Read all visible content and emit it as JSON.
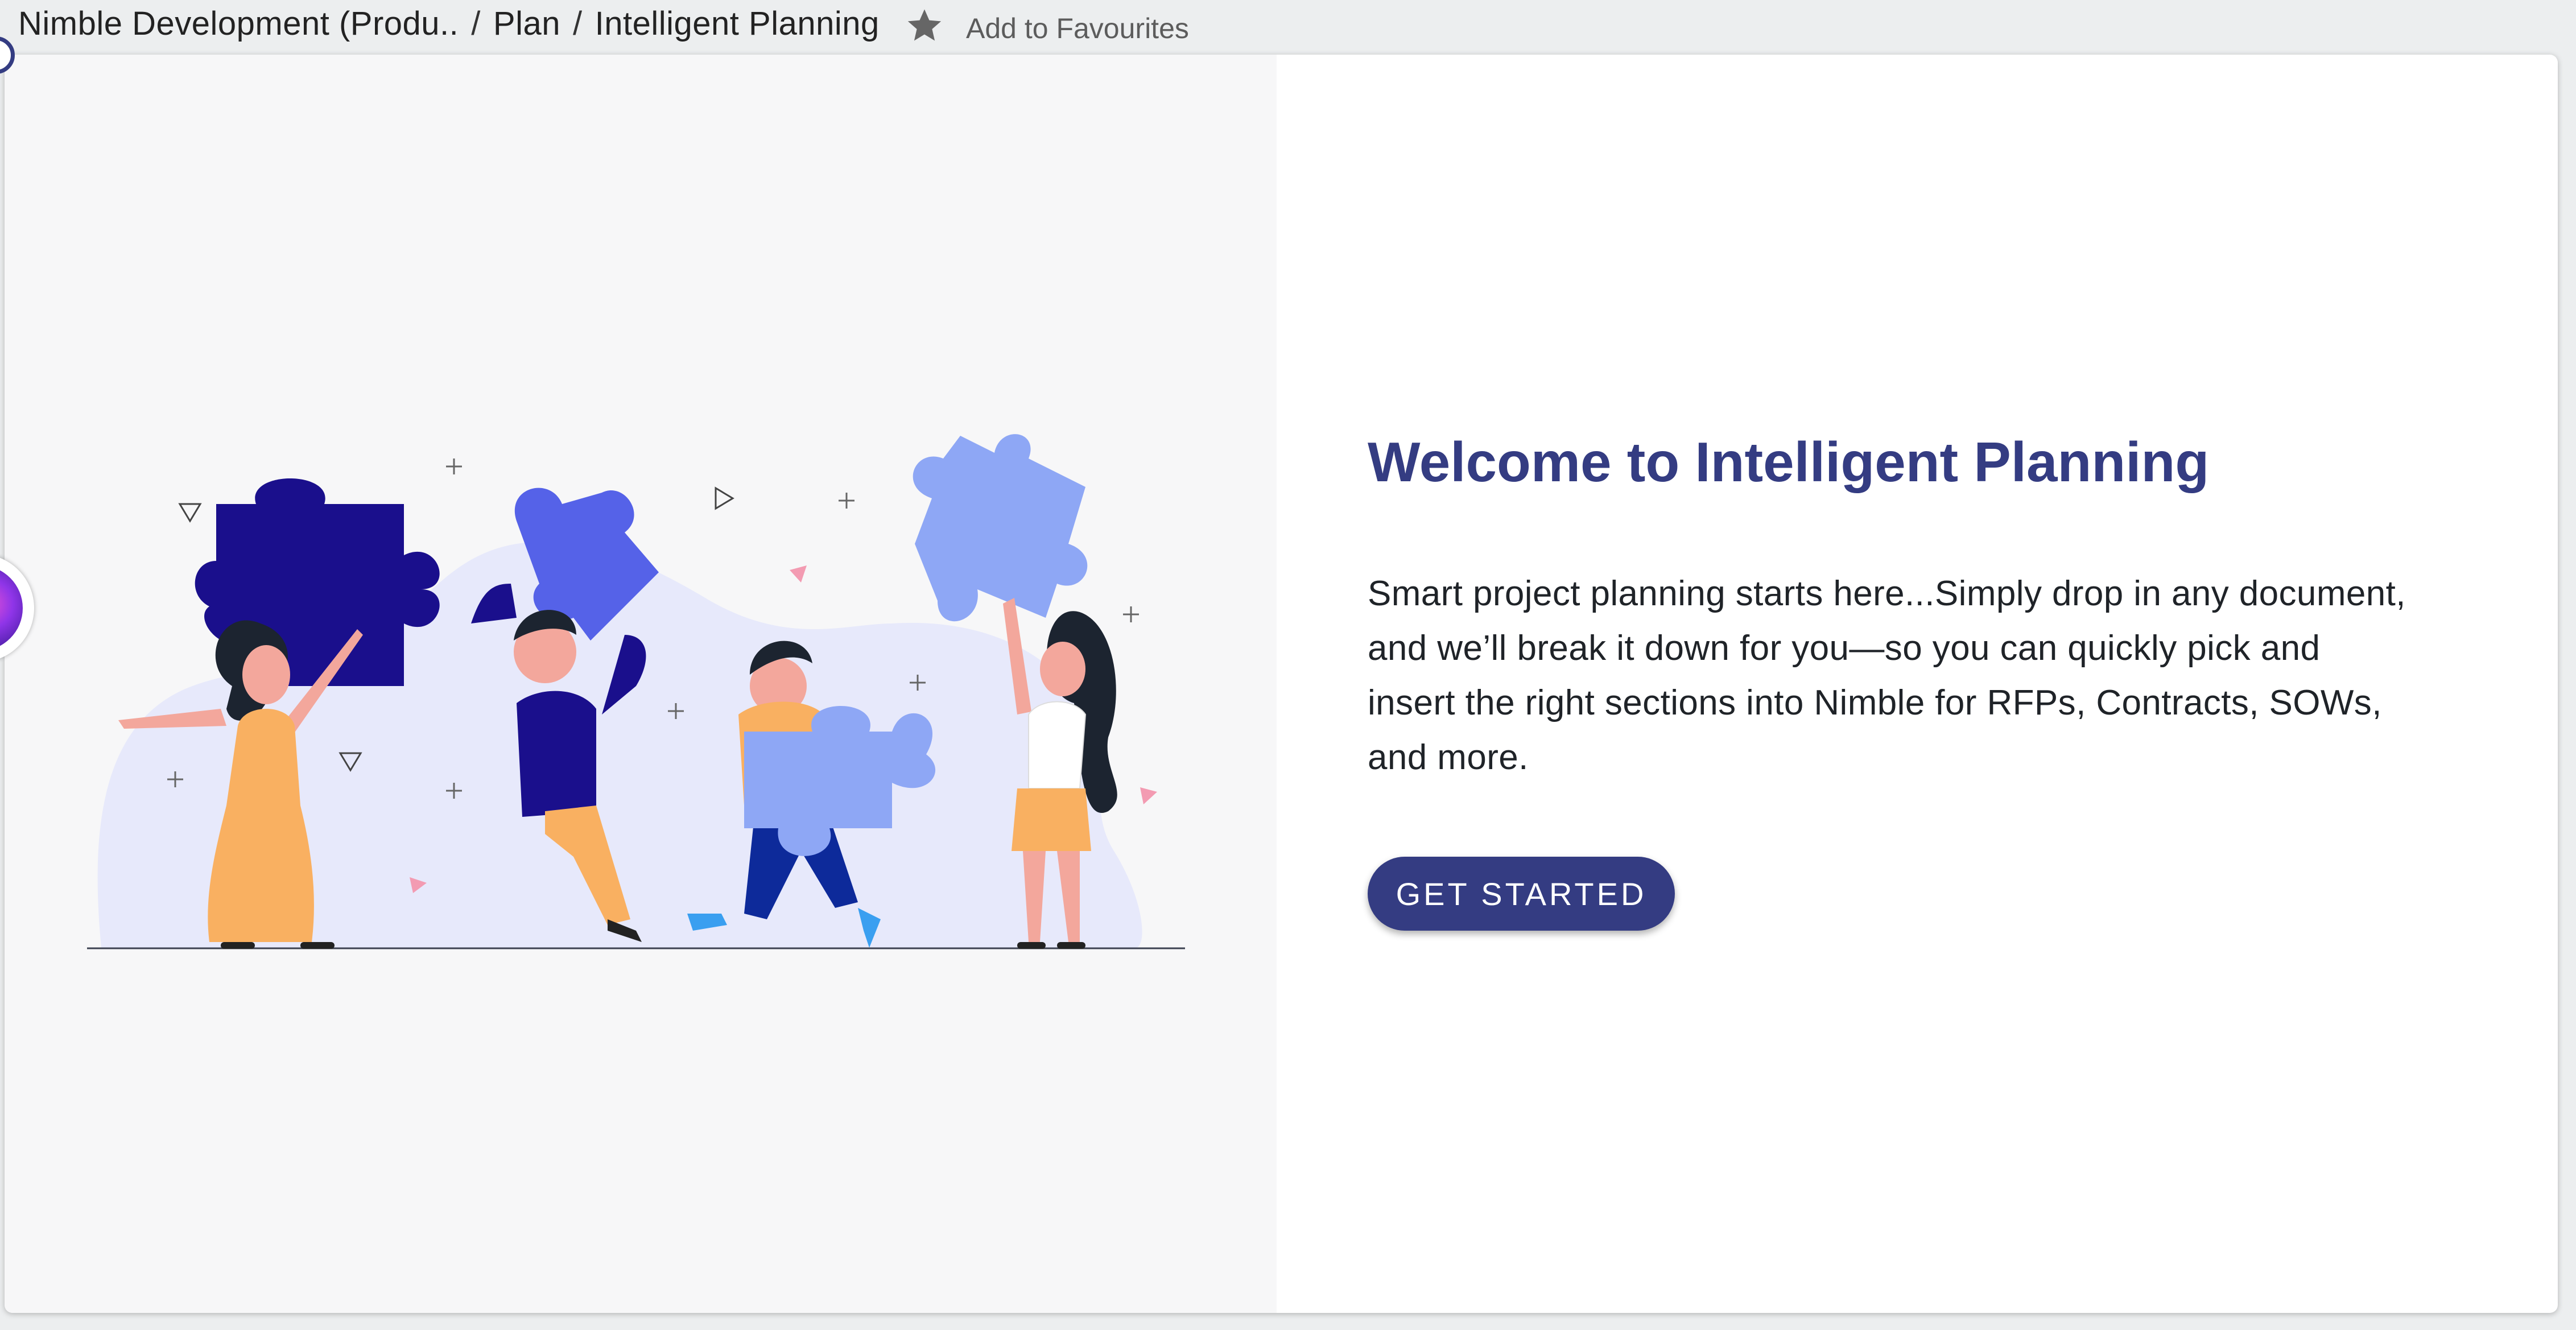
{
  "breadcrumb": {
    "items": [
      "Nimble Development (Produ..",
      "Plan",
      "Intelligent Planning"
    ],
    "separator": "/"
  },
  "favourites": {
    "label": "Add to Favourites",
    "icon": "star-icon"
  },
  "welcome": {
    "title": "Welcome to Intelligent Planning",
    "description": "Smart project planning starts here...Simply drop in any document, and we’ll break it down for you—so you can quickly pick and insert the right sections into Nimble for RFPs, Contracts, SOWs, and more.",
    "cta_label": "GET STARTED"
  },
  "illustration": {
    "subject": "people-holding-puzzle-pieces"
  },
  "colors": {
    "accent": "#343c82",
    "page_bg": "#eceeef",
    "illustration_bg": "#f7f7f8",
    "puzzle_dark": "#1a0f8c",
    "puzzle_mid": "#5562e8",
    "puzzle_light": "#8ea7f5",
    "skin": "#f3a79c",
    "dress": "#f9b061"
  }
}
